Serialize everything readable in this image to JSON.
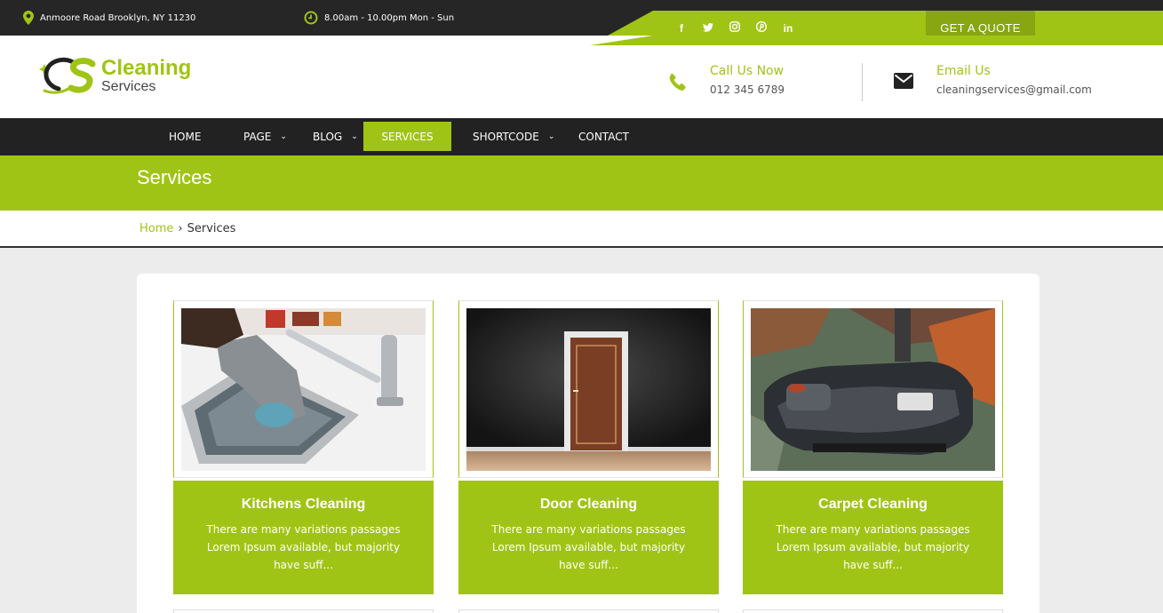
{
  "topbar": {
    "address": "Anmoore Road Brooklyn, NY 11230",
    "hours": "8.00am - 10.00pm Mon - Sun",
    "social_icons": [
      "facebook-icon",
      "twitter-icon",
      "instagram-icon",
      "pinterest-icon",
      "linkedin-icon"
    ],
    "social": {
      "facebook": "f",
      "twitter": "t",
      "instagram": "◎",
      "pinterest": "p",
      "linkedin": "in"
    },
    "quote_label": "GET A QUOTE"
  },
  "header": {
    "logo_line1": "Cleaning",
    "logo_line2": "Services",
    "call_title": "Call Us Now",
    "call_value": "012 345 6789",
    "email_title": "Email Us",
    "email_value": "cleaningservices@gmail.com"
  },
  "nav": {
    "items": [
      {
        "label": "HOME",
        "dropdown": false,
        "active": false
      },
      {
        "label": "PAGE",
        "dropdown": true,
        "active": false
      },
      {
        "label": "BLOG",
        "dropdown": true,
        "active": false
      },
      {
        "label": "SERVICES",
        "dropdown": false,
        "active": true
      },
      {
        "label": "SHORTCODE",
        "dropdown": true,
        "active": false
      },
      {
        "label": "CONTACT",
        "dropdown": false,
        "active": false
      }
    ]
  },
  "page": {
    "title": "Services",
    "breadcrumb_home": "Home",
    "breadcrumb_sep": "›",
    "breadcrumb_current": "Services"
  },
  "services": [
    {
      "title": "Kitchens Cleaning",
      "text": "There are many variations passages Lorem Ipsum available, but majority have suff..."
    },
    {
      "title": "Door Cleaning",
      "text": "There are many variations passages Lorem Ipsum available, but majority have suff..."
    },
    {
      "title": "Carpet Cleaning",
      "text": "There are many variations passages Lorem Ipsum available, but majority have suff..."
    }
  ],
  "colors": {
    "accent": "#a0c415",
    "dark": "#222222",
    "quote_button": "#87a612"
  }
}
